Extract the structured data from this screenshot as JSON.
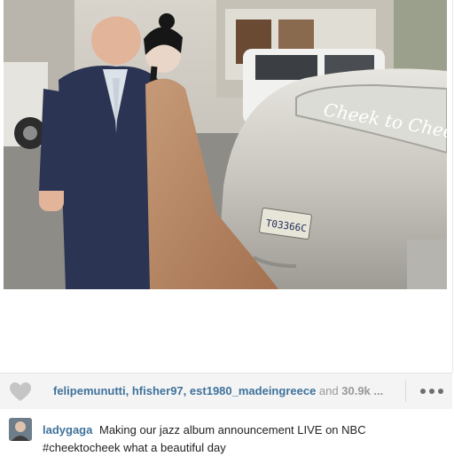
{
  "post": {
    "likes": {
      "likers": [
        "felipemunutti",
        "hfisher97",
        "est1980_madeingreece"
      ],
      "separator": ",",
      "and_text": "and",
      "more_count": "30.9k ..."
    },
    "caption": {
      "username": "ladygaga",
      "text": "Making our jazz album announcement LIVE on NBC #cheektocheek what a beautiful day"
    },
    "photo": {
      "car_window_text": "Cheek to Cheek",
      "license_plate": "T03366C"
    }
  },
  "colors": {
    "link": "#3f729b",
    "muted": "#999999",
    "likes_bar": "#f4f4f4"
  },
  "icons": {
    "like": "heart-icon",
    "more": "more-options-icon"
  }
}
